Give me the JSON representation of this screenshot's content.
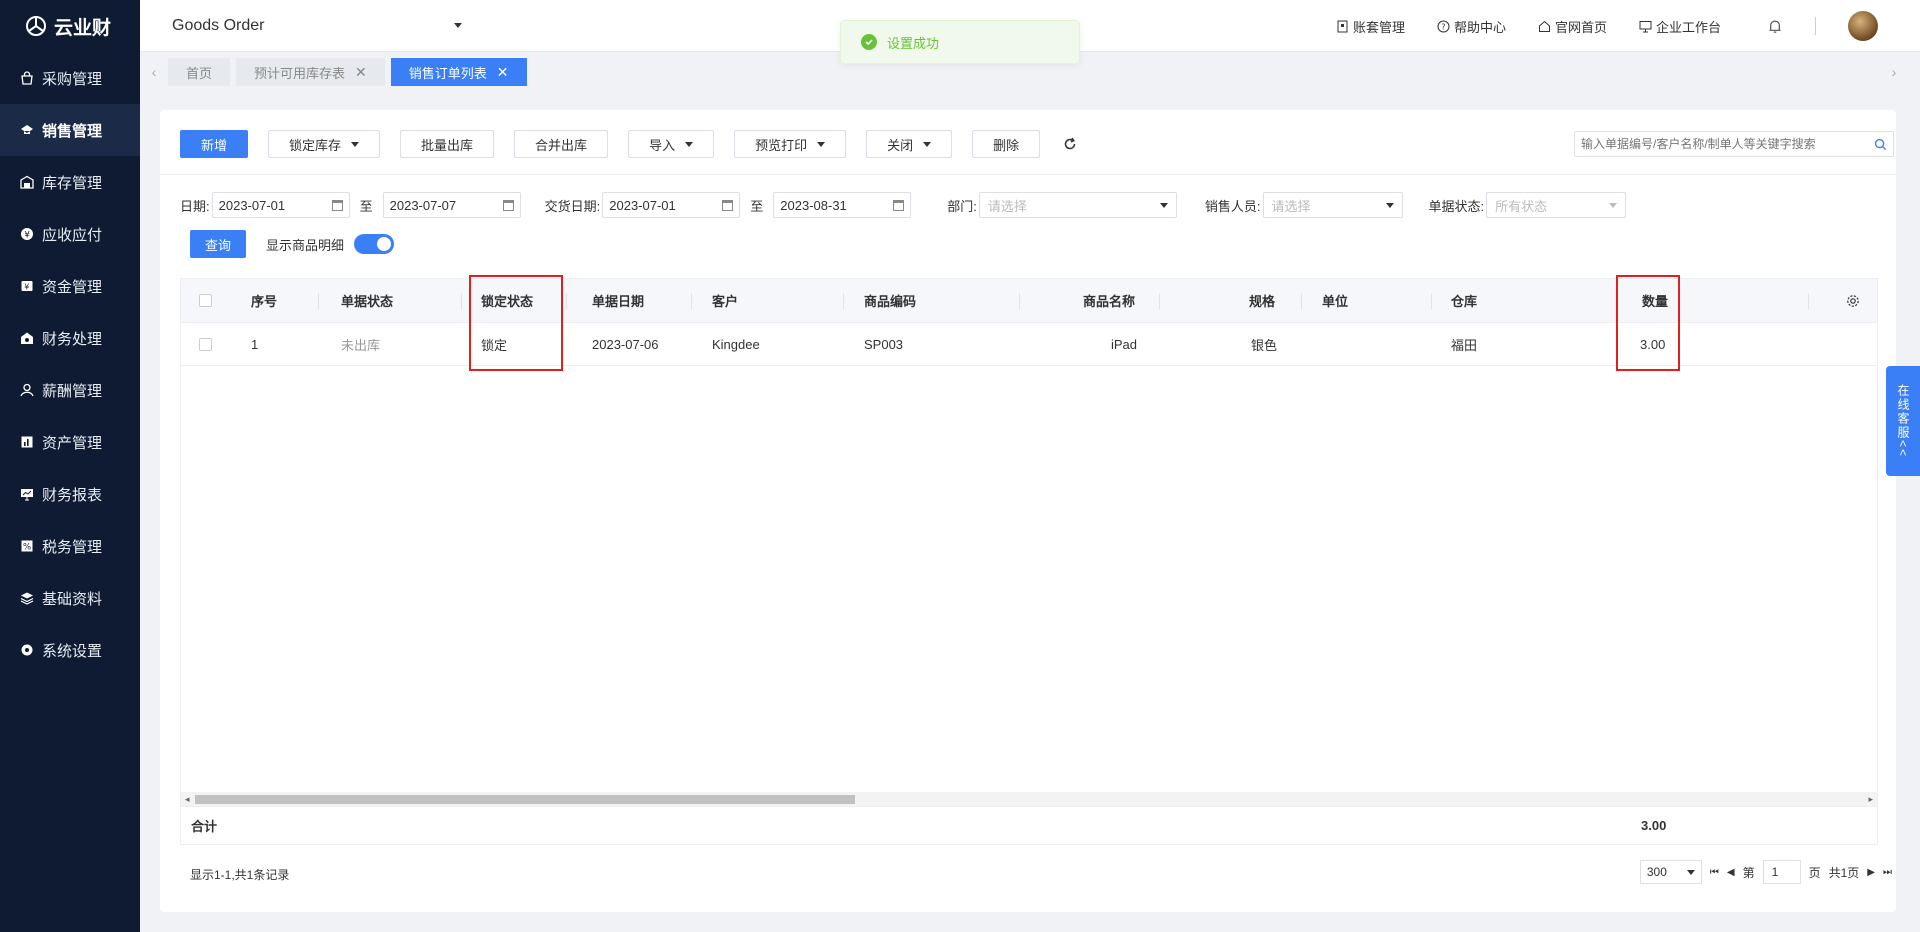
{
  "app": {
    "logo_text": "云业财",
    "org_name": "Goods Order"
  },
  "sidebar": {
    "items": [
      {
        "label": "采购管理",
        "icon": "bag-icon"
      },
      {
        "label": "销售管理",
        "icon": "sales-icon"
      },
      {
        "label": "库存管理",
        "icon": "warehouse-icon"
      },
      {
        "label": "应收应付",
        "icon": "coin-icon"
      },
      {
        "label": "资金管理",
        "icon": "wallet-icon"
      },
      {
        "label": "财务处理",
        "icon": "finance-icon"
      },
      {
        "label": "薪酬管理",
        "icon": "salary-icon"
      },
      {
        "label": "资产管理",
        "icon": "asset-icon"
      },
      {
        "label": "财务报表",
        "icon": "report-icon"
      },
      {
        "label": "税务管理",
        "icon": "tax-icon"
      },
      {
        "label": "基础资料",
        "icon": "layers-icon"
      },
      {
        "label": "系统设置",
        "icon": "gear-icon"
      }
    ],
    "active_index": 1
  },
  "header": {
    "links": [
      "账套管理",
      "帮助中心",
      "官网首页",
      "企业工作台"
    ]
  },
  "toast": {
    "text": "设置成功"
  },
  "tabs": [
    {
      "label": "首页",
      "closable": false,
      "active": false
    },
    {
      "label": "预计可用库存表",
      "closable": true,
      "active": false
    },
    {
      "label": "销售订单列表",
      "closable": true,
      "active": true
    }
  ],
  "toolbar": {
    "new": "新增",
    "lock_stock": "锁定库存",
    "batch_out": "批量出库",
    "merge_out": "合并出库",
    "import": "导入",
    "preview_print": "预览打印",
    "close": "关闭",
    "delete": "删除",
    "search_placeholder": "输入单据编号/客户名称/制单人等关键字搜索"
  },
  "filters": {
    "date_label": "日期:",
    "date_from": "2023-07-01",
    "to": "至",
    "date_to": "2023-07-07",
    "delivery_label": "交货日期:",
    "delivery_from": "2023-07-01",
    "delivery_to": "2023-08-31",
    "dept_label": "部门:",
    "dept_placeholder": "请选择",
    "sales_label": "销售人员:",
    "sales_placeholder": "请选择",
    "status_label": "单据状态:",
    "status_value": "所有状态",
    "query": "查询",
    "show_detail": "显示商品明细"
  },
  "table": {
    "columns": [
      "序号",
      "单据状态",
      "锁定状态",
      "单据日期",
      "客户",
      "商品编码",
      "商品名称",
      "规格",
      "单位",
      "仓库",
      "数量"
    ],
    "rows": [
      {
        "seq": "1",
        "status": "未出库",
        "lock": "锁定",
        "date": "2023-07-06",
        "customer": "Kingdee",
        "code": "SP003",
        "name": "iPad",
        "spec": "银色",
        "unit": "",
        "warehouse": "福田",
        "qty": "3.00"
      }
    ],
    "total_label": "合计",
    "total_qty": "3.00"
  },
  "pager": {
    "info": "显示1-1,共1条记录",
    "page_size": "300",
    "page_prefix": "第",
    "page": "1",
    "page_suffix": "页",
    "total_pages": "共1页"
  },
  "service": {
    "label": "在线客服<<"
  }
}
